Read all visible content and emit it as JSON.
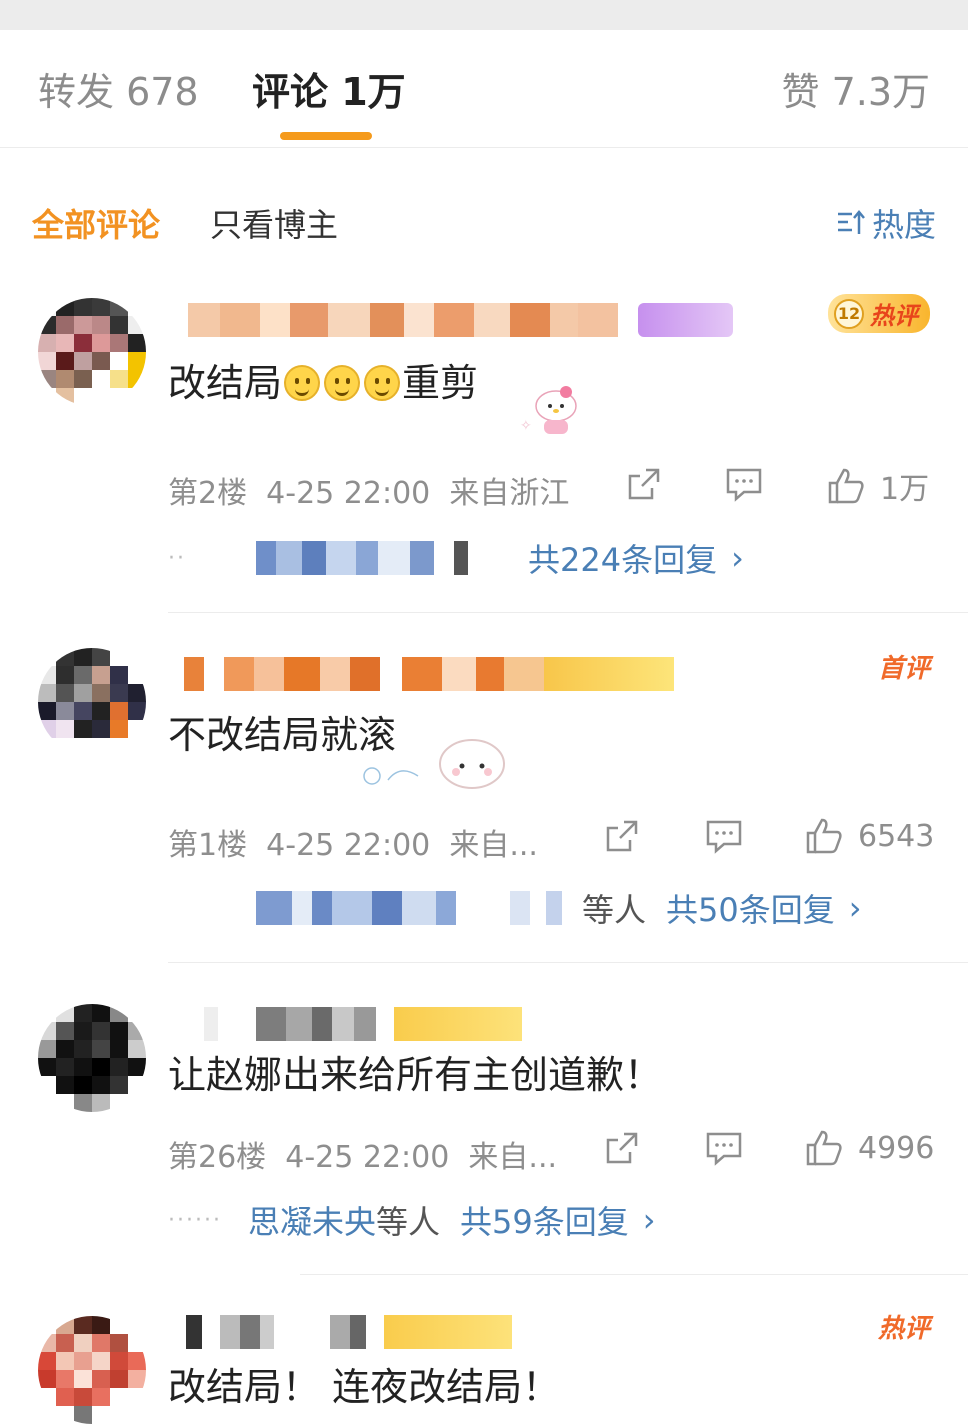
{
  "tabs": {
    "repost": "转发 678",
    "comments": "评论 1万",
    "likes": "赞 7.3万"
  },
  "filter": {
    "all": "全部评论",
    "blogger_only": "只看博主",
    "sort": "热度"
  },
  "comments": [
    {
      "badge_level": "12",
      "badge": "热评",
      "text": "改结局",
      "text_after": "重剪",
      "floor": "第2楼",
      "time": "4-25 22:00",
      "location": "来自浙江",
      "likes": "1万",
      "reply_count": "共224条回复"
    },
    {
      "badge": "首评",
      "text": "不改结局就滚",
      "floor": "第1楼",
      "time": "4-25 22:00",
      "location": "来自...",
      "likes": "6543",
      "reply_others": "等人",
      "reply_count": "共50条回复"
    },
    {
      "text": "让赵娜出来给所有主创道歉！",
      "floor": "第26楼",
      "time": "4-25 22:00",
      "location": "来自...",
      "likes": "4996",
      "reply_user": "思凝未央",
      "reply_others": "等人",
      "reply_count": "共59条回复"
    },
    {
      "badge": "热评",
      "text": "改结局！ 连夜改结局！"
    }
  ],
  "icons": {
    "repost": "share-icon",
    "comment": "comment-icon",
    "like": "thumbs-up-icon",
    "sort": "sort-icon",
    "chevron": "chevron-right-icon"
  },
  "colors": {
    "accent_orange": "#f29222",
    "link_blue": "#4a7fb5",
    "tab_underline": "#f59a1b"
  }
}
